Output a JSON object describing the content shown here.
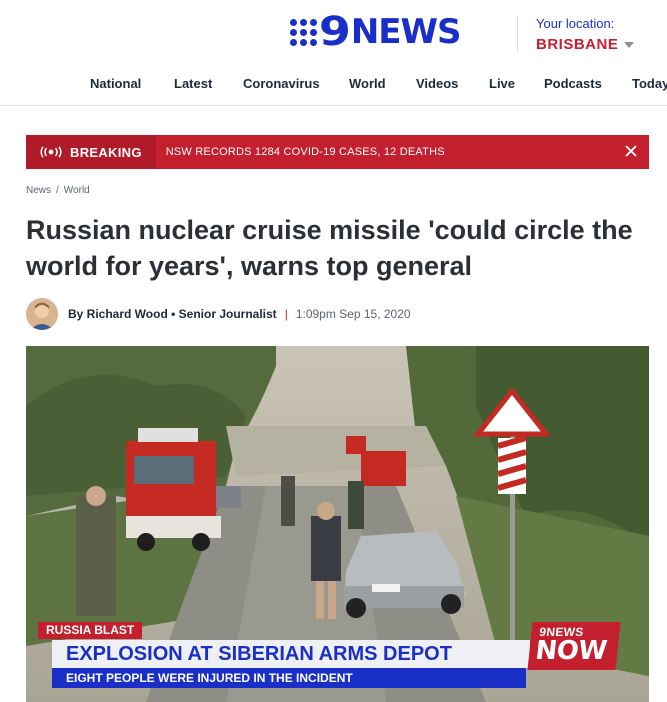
{
  "brand": {
    "logo_text": "NEWS",
    "logo_nine": "9",
    "color": "#1a2fc8"
  },
  "location": {
    "label": "Your location:",
    "city": "BRISBANE"
  },
  "nav": [
    "National",
    "Latest",
    "Coronavirus",
    "World",
    "Videos",
    "Live",
    "Podcasts",
    "Today"
  ],
  "breaking": {
    "tag": "BREAKING",
    "text": "NSW RECORDS 1284 COVID-19 CASES, 12 DEATHS",
    "color": "#c41f2e"
  },
  "breadcrumb": [
    "News",
    "World"
  ],
  "article": {
    "title": "Russian nuclear cruise missile 'could circle the world for years', warns top general",
    "author": "By Richard Wood • Senior Journalist",
    "date": "1:09pm Sep 15, 2020"
  },
  "video_overlay": {
    "tag": "RUSSIA BLAST",
    "headline": "EXPLOSION AT SIBERIAN ARMS DEPOT",
    "subline": "EIGHT PEOPLE WERE INJURED IN THE INCIDENT",
    "badge_top": "9NEWS",
    "badge_word": "NOW"
  }
}
